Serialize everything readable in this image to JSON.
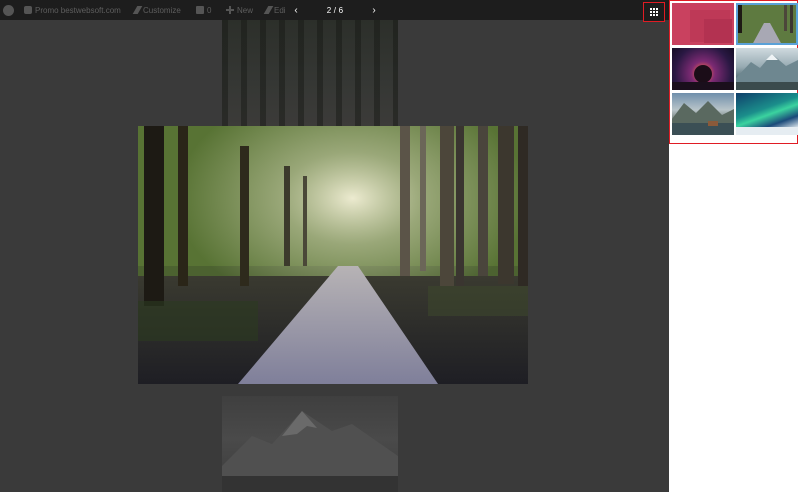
{
  "admin_bar": {
    "items": [
      {
        "icon": "wordpress-logo-icon",
        "label": ""
      },
      {
        "icon": "home-icon",
        "label": "Promo bestwebsoft.com"
      },
      {
        "icon": "customize-brush-icon",
        "label": "Customize"
      },
      {
        "icon": "comment-bubble-icon",
        "label": "0"
      },
      {
        "icon": "plus-icon",
        "label": "New"
      },
      {
        "icon": "edit-pencil-icon",
        "label": "Edi"
      }
    ]
  },
  "lightbox": {
    "counter": "2 / 6",
    "prev_icon": "chevron-left-icon",
    "next_icon": "chevron-right-icon",
    "prev_symbol": "‹",
    "next_symbol": "›",
    "grid_toggle_icon": "grid-dots-icon",
    "current_index": 2,
    "total": 6
  },
  "thumbnails": [
    {
      "name": "thumb-pink-placeholder",
      "active": false
    },
    {
      "name": "thumb-forest-road",
      "active": true
    },
    {
      "name": "thumb-purple-tree",
      "active": false
    },
    {
      "name": "thumb-snowy-mountains",
      "active": false
    },
    {
      "name": "thumb-mountain-lake-cabin",
      "active": false
    },
    {
      "name": "thumb-aurora",
      "active": false
    }
  ],
  "colors": {
    "highlight_border": "#e01c24",
    "active_thumb_outline": "#5aa1d8",
    "overlay_bg": "#3a3a3a",
    "admin_bar_bg": "#1d1d1d"
  }
}
